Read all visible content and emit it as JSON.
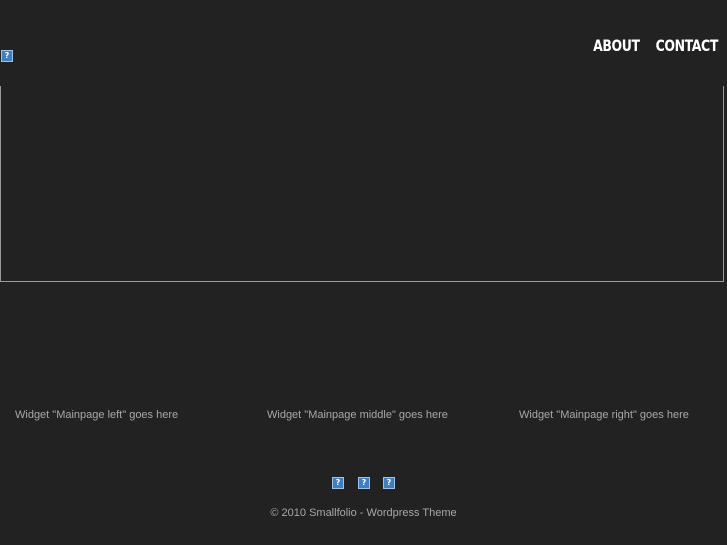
{
  "header": {
    "logo_icon": "broken-image-icon",
    "nav": [
      {
        "label": "ABOUT"
      },
      {
        "label": "CONTACT"
      }
    ]
  },
  "widgets": {
    "left": "Widget \"Mainpage left\" goes here",
    "middle": "Widget \"Mainpage middle\" goes here",
    "right": "Widget \"Mainpage right\" goes here"
  },
  "social": {
    "icons": [
      "broken-image-icon",
      "broken-image-icon",
      "broken-image-icon"
    ]
  },
  "footer": {
    "copyright": "© 2010 Smallfolio - Wordpress Theme"
  },
  "colors": {
    "background": "#222222",
    "nav_text": "#ffffff",
    "body_text": "#a8a8a8",
    "border": "#9a9a9a",
    "broken_image": "#3f7fbf"
  }
}
